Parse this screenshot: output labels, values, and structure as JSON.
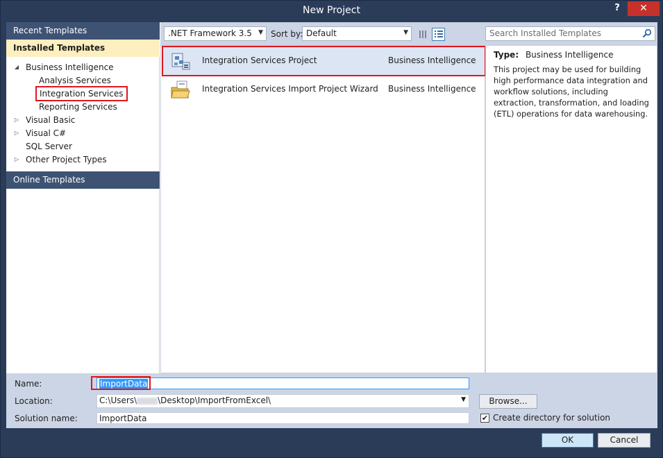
{
  "window": {
    "title": "New Project",
    "help": "?",
    "close": "✕"
  },
  "left": {
    "recent_templates": "Recent Templates",
    "installed_templates": "Installed Templates",
    "online_templates": "Online Templates",
    "tree": [
      {
        "label": "Business Intelligence",
        "expanded": true
      },
      {
        "label": "Analysis Services"
      },
      {
        "label": "Integration Services",
        "selected": true
      },
      {
        "label": "Reporting Services"
      },
      {
        "label": "Visual Basic",
        "expanded": false
      },
      {
        "label": "Visual C#",
        "expanded": false
      },
      {
        "label": "SQL Server"
      },
      {
        "label": "Other Project Types",
        "expanded": false
      }
    ]
  },
  "toolbar": {
    "framework": ".NET Framework 3.5",
    "sort_label": "Sort by:",
    "sort_value": "Default"
  },
  "templates": [
    {
      "name": "Integration Services Project",
      "type": "Business Intelligence",
      "icon": "ssis-project-icon",
      "selected": true
    },
    {
      "name": "Integration Services Import Project Wizard",
      "type": "Business Intelligence",
      "icon": "folder-wizard-icon",
      "selected": false
    }
  ],
  "search": {
    "placeholder": "Search Installed Templates"
  },
  "details": {
    "type_label": "Type:",
    "type_value": "Business Intelligence",
    "description": "This project may be used for building high performance data integration and workflow solutions, including extraction, transformation, and loading (ETL) operations for data warehousing."
  },
  "form": {
    "name_label": "Name:",
    "name_value": "ImportData",
    "location_label": "Location:",
    "location_value_prefix": "C:\\Users\\",
    "location_value_suffix": "\\Desktop\\ImportFromExcel\\",
    "browse": "Browse...",
    "solution_label": "Solution name:",
    "solution_value": "ImportData",
    "create_dir": "Create directory for solution",
    "create_dir_checked": true
  },
  "buttons": {
    "ok": "OK",
    "cancel": "Cancel"
  },
  "colors": {
    "titlebar": "#2b3c59",
    "accent_red": "#e0161c",
    "close": "#c7312b"
  }
}
